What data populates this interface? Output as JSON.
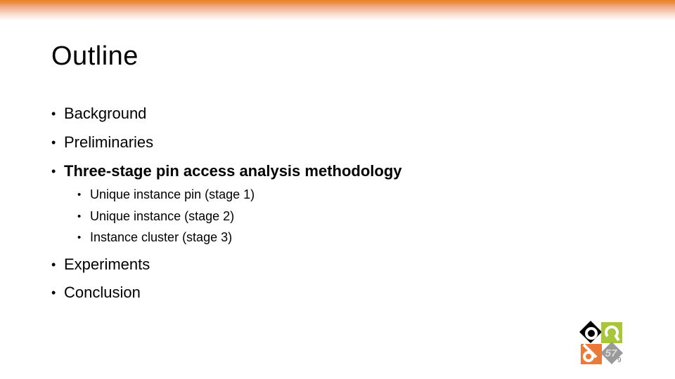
{
  "slide": {
    "title": "Outline",
    "bullets": [
      {
        "text": "Background",
        "level": 1,
        "bold": false
      },
      {
        "text": "Preliminaries",
        "level": 1,
        "bold": false
      },
      {
        "text": "Three-stage pin access analysis methodology",
        "level": 1,
        "bold": true
      },
      {
        "text": "Unique instance pin (stage 1)",
        "level": 2,
        "bold": false
      },
      {
        "text": "Unique instance (stage 2)",
        "level": 2,
        "bold": false
      },
      {
        "text": "Instance cluster (stage 3)",
        "level": 2,
        "bold": false
      },
      {
        "text": "Experiments",
        "level": 1,
        "bold": false
      },
      {
        "text": "Conclusion",
        "level": 1,
        "bold": false
      }
    ],
    "bullet_glyph": "•",
    "page_number": "9",
    "logo": {
      "name": "conference-logo",
      "label": "57",
      "colors": {
        "black": "#000000",
        "green": "#a7c638",
        "orange": "#ea7a3a",
        "gray": "#9a9a9a"
      }
    },
    "accent_color": "#e6852a"
  }
}
